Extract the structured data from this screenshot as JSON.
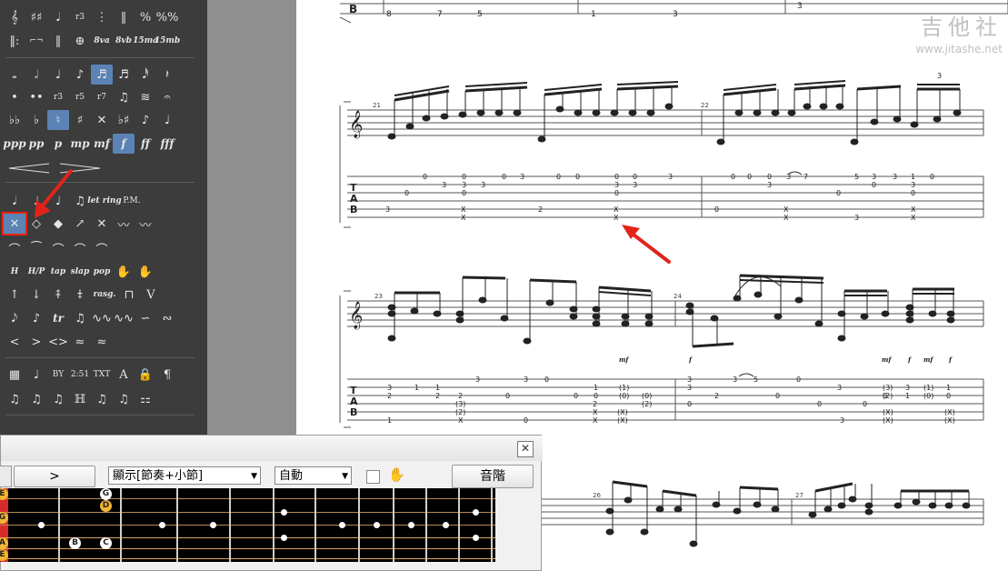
{
  "palette": {
    "row0": [
      "𝄞",
      "♯♯",
      "𝅘𝅥",
      "r3",
      "⋮",
      "‖",
      "%",
      "%%"
    ],
    "row1": [
      "‖:",
      "⌐¬",
      "‖",
      "⊕",
      "8va",
      "8vb",
      "15ma",
      "15mb"
    ],
    "durations": [
      "𝅝",
      "𝅗𝅥",
      "♩",
      "♪",
      "♬",
      "♬",
      "𝅘𝅥𝅰",
      "𝄽"
    ],
    "tuplets": [
      "•",
      "••",
      "r3",
      "r5",
      "r7",
      "♫",
      "≋",
      "𝄐"
    ],
    "accidentals": [
      "♭♭",
      "♭",
      "♮",
      "♯",
      "✕",
      "♭♯",
      "♪",
      "♩"
    ],
    "dynamics": [
      "ppp",
      "pp",
      "p",
      "mp",
      "mf",
      "f",
      "ff",
      "fff"
    ],
    "artic1": [
      "𝅘𝅥",
      "♩",
      "♩",
      "♫",
      "let ring",
      "P.M."
    ],
    "artic2": [
      "✕",
      "◇",
      "◆",
      "↗",
      "✕",
      "〰",
      "〰"
    ],
    "artic3": [
      "⌒",
      "⁀",
      "⌒",
      "⌒",
      "⌒"
    ],
    "artic4": [
      "H",
      "H/P",
      "tap",
      "slap",
      "pop",
      "✋",
      "✋"
    ],
    "artic5": [
      "↑",
      "↓",
      "⤉",
      "⤈",
      "rasg.",
      "⊓",
      "V"
    ],
    "artic6": [
      "𝅘𝅥𝅮",
      "♪",
      "tr",
      "♫",
      "∿∿",
      "∿∿",
      "∽",
      "∾"
    ],
    "artic7": [
      "<",
      ">",
      "<>",
      "≈",
      "≈"
    ],
    "misc1": [
      "▦",
      "♩",
      "BY",
      "2:51",
      "TXT",
      "A",
      "🔒",
      "¶"
    ],
    "misc2": [
      "♫",
      "♫",
      "♫",
      "ℍ",
      "♫",
      "♫",
      "⚏"
    ]
  },
  "watermark": {
    "cn": "吉他社",
    "url": "www.jitashe.net"
  },
  "score": {
    "measures": [
      "21",
      "22",
      "23",
      "24",
      "26",
      "27"
    ],
    "dynamics_row1": [
      "mf",
      "f",
      "mf",
      "f",
      "mf",
      "f"
    ]
  },
  "panel": {
    "next_button": ">",
    "display_select": "顯示[節奏+小節]",
    "auto_select": "自動",
    "scale_button": "音階",
    "close": "✕"
  },
  "fretboard": {
    "left_labels": [
      "E",
      "G",
      "A",
      "E"
    ],
    "notes": [
      "G",
      "D",
      "B",
      "C"
    ]
  }
}
